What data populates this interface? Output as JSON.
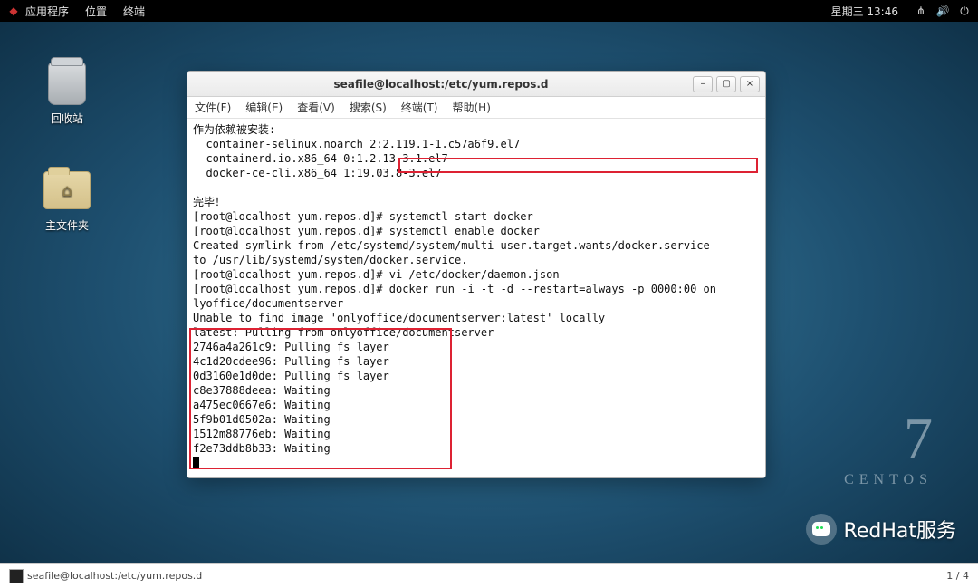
{
  "panel": {
    "menu": {
      "applications": "应用程序",
      "places": "位置",
      "terminal": "终端"
    },
    "clock": "星期三 13:46",
    "icons": {
      "network": "network-icon",
      "volume": "volume-icon",
      "power": "power-icon"
    }
  },
  "desktop": {
    "trash_label": "回收站",
    "home_label": "主文件夹"
  },
  "brand": {
    "version": "7",
    "name": "CENTOS"
  },
  "window": {
    "title": "seafile@localhost:/etc/yum.repos.d",
    "buttons": {
      "minimize": "–",
      "maximize": "▢",
      "close": "×"
    },
    "menubar": {
      "file": "文件(F)",
      "edit": "编辑(E)",
      "view": "查看(V)",
      "search": "搜索(S)",
      "terminal": "终端(T)",
      "help": "帮助(H)"
    }
  },
  "terminal": {
    "deps_header": "作为依赖被安装:",
    "dep1": "  container-selinux.noarch 2:2.119.1-1.c57a6f9.el7",
    "dep2": "  containerd.io.x86_64 0:1.2.13-3.1.el7",
    "dep3": "  docker-ce-cli.x86_64 1:19.03.8-3.el7",
    "done": "完毕！",
    "p1": "[root@localhost yum.repos.d]# systemctl start docker",
    "p2": "[root@localhost yum.repos.d]# systemctl enable docker",
    "symlink1": "Created symlink from /etc/systemd/system/multi-user.target.wants/docker.service",
    "symlink2": "to /usr/lib/systemd/system/docker.service.",
    "p3": "[root@localhost yum.repos.d]# vi /etc/docker/daemon.json",
    "p4a": "[root@localhost yum.repos.d]# ",
    "p4b": "docker run -i -t -d --restart=always -p 0000:00 on",
    "p4c": "lyoffice/documentserver",
    "noimage": "Unable to find image 'onlyoffice/documentserver:latest' locally",
    "pulling": "latest: Pulling from onlyoffice/documentserver",
    "l1": "2746a4a261c9: Pulling fs layer",
    "l2": "4c1d20cdee96: Pulling fs layer",
    "l3": "0d3160e1d0de: Pulling fs layer",
    "l4": "c8e37888deea: Waiting",
    "l5": "a475ec0667e6: Waiting",
    "l6": "5f9b01d0502a: Waiting",
    "l7": "1512m88776eb: Waiting",
    "l8": "f2e73ddb8b33: Waiting"
  },
  "footer": {
    "task_title": "seafile@localhost:/etc/yum.repos.d",
    "page": "1 / 4"
  },
  "wechat": {
    "label": "RedHat服务"
  }
}
